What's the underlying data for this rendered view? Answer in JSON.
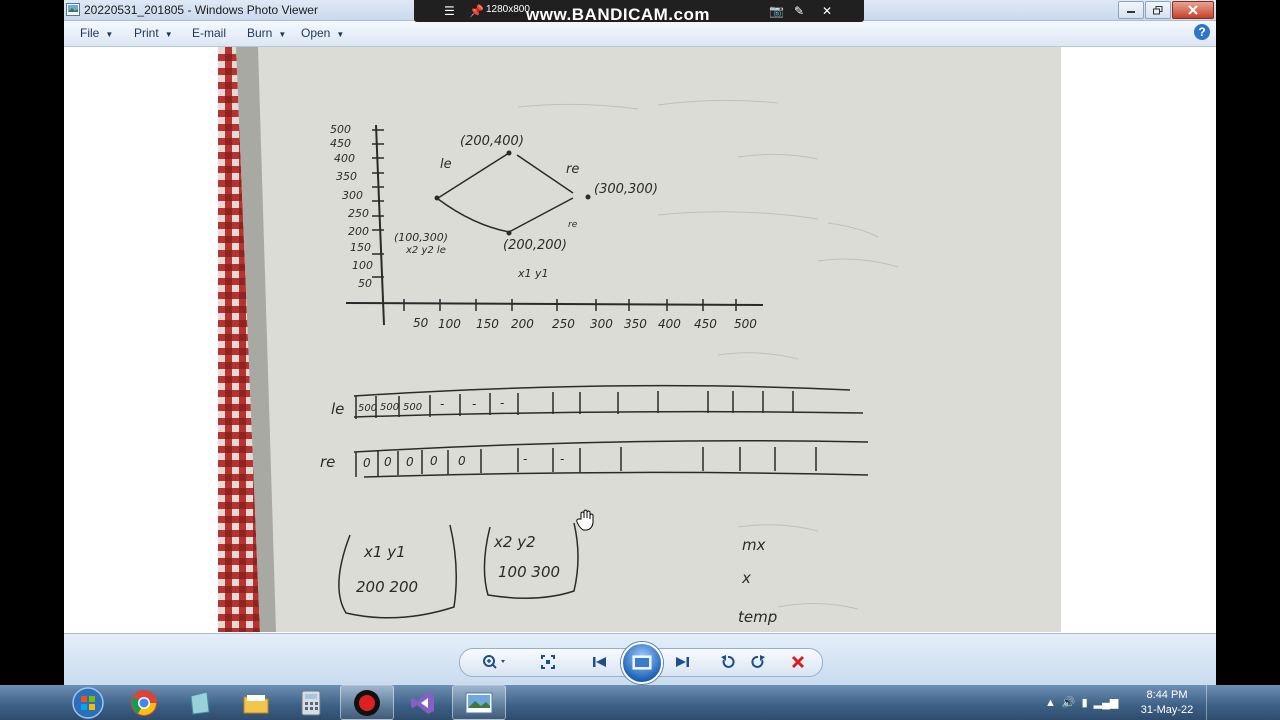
{
  "window": {
    "title": "20220531_201805 - Windows Photo Viewer"
  },
  "menu": {
    "file": "File",
    "print": "Print",
    "email": "E-mail",
    "burn": "Burn",
    "open": "Open"
  },
  "recorder": {
    "resolution": "1280x800",
    "brand": "www.BANDICAM.com"
  },
  "photo": {
    "graph_labels": {
      "y_ticks": [
        "500",
        "450",
        "400",
        "350",
        "300",
        "250",
        "200",
        "150",
        "100",
        "50"
      ],
      "x_ticks": [
        "50",
        "100",
        "150",
        "200",
        "250",
        "300",
        "350",
        "400",
        "450",
        "500"
      ],
      "top_point": "(200,400)",
      "right_point": "(300,300)",
      "left_point": "(100,300)",
      "bottom_point": "(200,200)",
      "le": "le",
      "re": "re",
      "left_sub": "x2 y2 le",
      "bottom_sub": "x1 y1",
      "re_small": "re"
    },
    "arrays": {
      "le_label": "le",
      "le_cells": [
        "500",
        "500",
        "500",
        "-",
        "-",
        "-",
        "",
        "",
        "",
        "",
        "",
        "",
        "",
        "",
        ""
      ],
      "re_label": "re",
      "re_cells": [
        "0",
        "0",
        "0",
        "0",
        "0",
        "-",
        "-",
        "",
        "",
        "",
        "",
        "",
        "",
        "",
        ""
      ]
    },
    "boxes": {
      "box1_head": "x1   y1",
      "box1_vals": "200  200",
      "box2_head": "x2   y2",
      "box2_vals": "100  300"
    },
    "notes": {
      "mx": "mx",
      "x": "x",
      "temp": "temp"
    }
  },
  "taskbar": {
    "time": "8:44 PM",
    "date": "31-May-22"
  }
}
